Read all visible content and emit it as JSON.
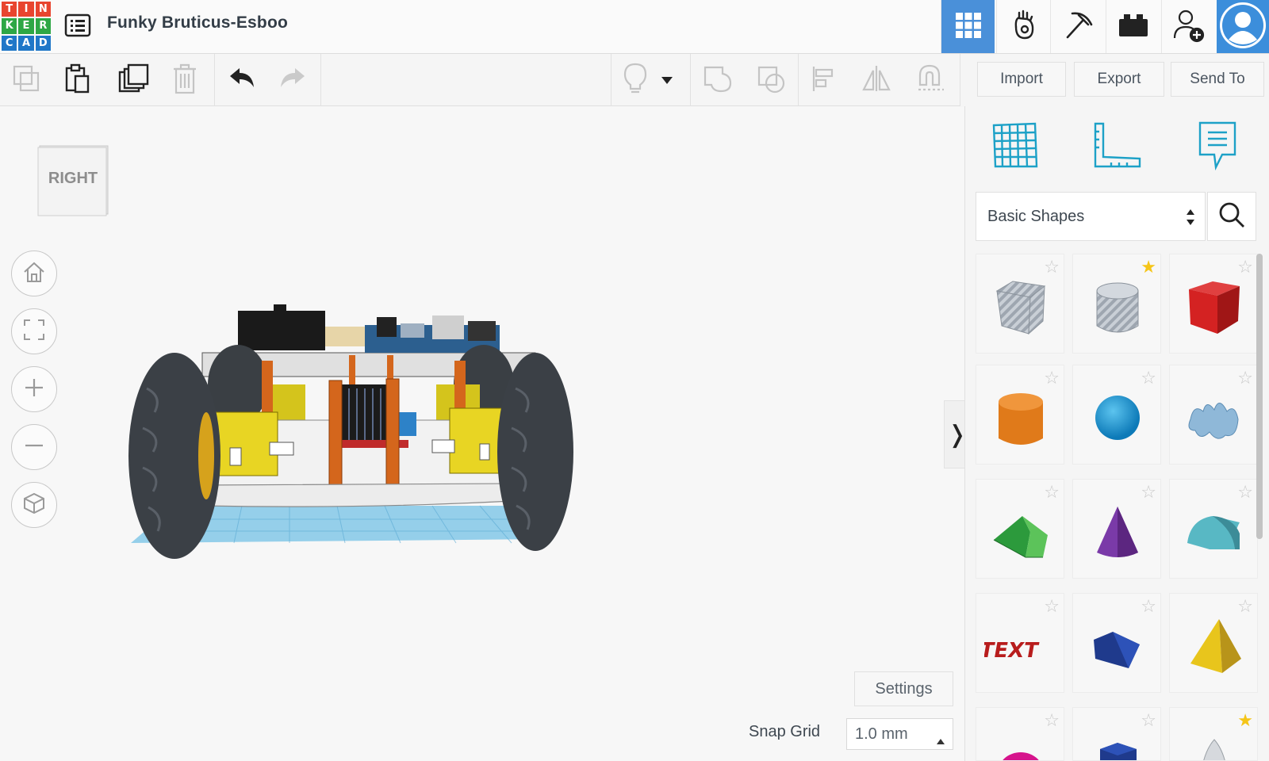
{
  "app": {
    "logo_letters": [
      "T",
      "I",
      "N",
      "K",
      "E",
      "R",
      "C",
      "A",
      "D"
    ],
    "logo_colors": [
      "#e8452f",
      "#e8452f",
      "#e8452f",
      "#2da745",
      "#2da745",
      "#2da745",
      "#1f77c8",
      "#1f77c8",
      "#1f77c8"
    ],
    "project_title": "Funky Bruticus-Esboo"
  },
  "header": {
    "nav_items": [
      {
        "name": "3d-design-view",
        "icon": "grid-icon"
      },
      {
        "name": "blocks-view",
        "icon": "hand-icon"
      },
      {
        "name": "bricks-view",
        "icon": "pickaxe-icon"
      },
      {
        "name": "sim-lab-view",
        "icon": "briefcase-icon"
      },
      {
        "name": "invite-user",
        "icon": "add-user-icon"
      },
      {
        "name": "user-profile",
        "icon": "avatar-icon"
      }
    ]
  },
  "toolbar": {
    "buttons": {
      "import": "Import",
      "export": "Export",
      "send_to": "Send To"
    }
  },
  "viewcube": {
    "face_label": "RIGHT"
  },
  "workplane": {
    "settings_label": "Settings",
    "snap_grid_label": "Snap Grid",
    "snap_grid_value": "1.0 mm"
  },
  "shapes_panel": {
    "category": "Basic Shapes",
    "shapes": [
      {
        "name": "box-hole",
        "favorite": false
      },
      {
        "name": "cylinder-hole",
        "favorite": true
      },
      {
        "name": "box",
        "favorite": false
      },
      {
        "name": "cylinder",
        "favorite": false
      },
      {
        "name": "sphere",
        "favorite": false
      },
      {
        "name": "scribble",
        "favorite": false
      },
      {
        "name": "roof",
        "favorite": false
      },
      {
        "name": "cone",
        "favorite": false
      },
      {
        "name": "round-roof",
        "favorite": false
      },
      {
        "name": "text",
        "favorite": false
      },
      {
        "name": "wedge",
        "favorite": false
      },
      {
        "name": "pyramid",
        "favorite": false
      },
      {
        "name": "half-sphere",
        "favorite": false
      },
      {
        "name": "polygon",
        "favorite": false
      },
      {
        "name": "paraboloid",
        "favorite": true
      }
    ]
  },
  "colors": {
    "accent": "#4a90d9",
    "panel_icon": "#1da1c7"
  }
}
